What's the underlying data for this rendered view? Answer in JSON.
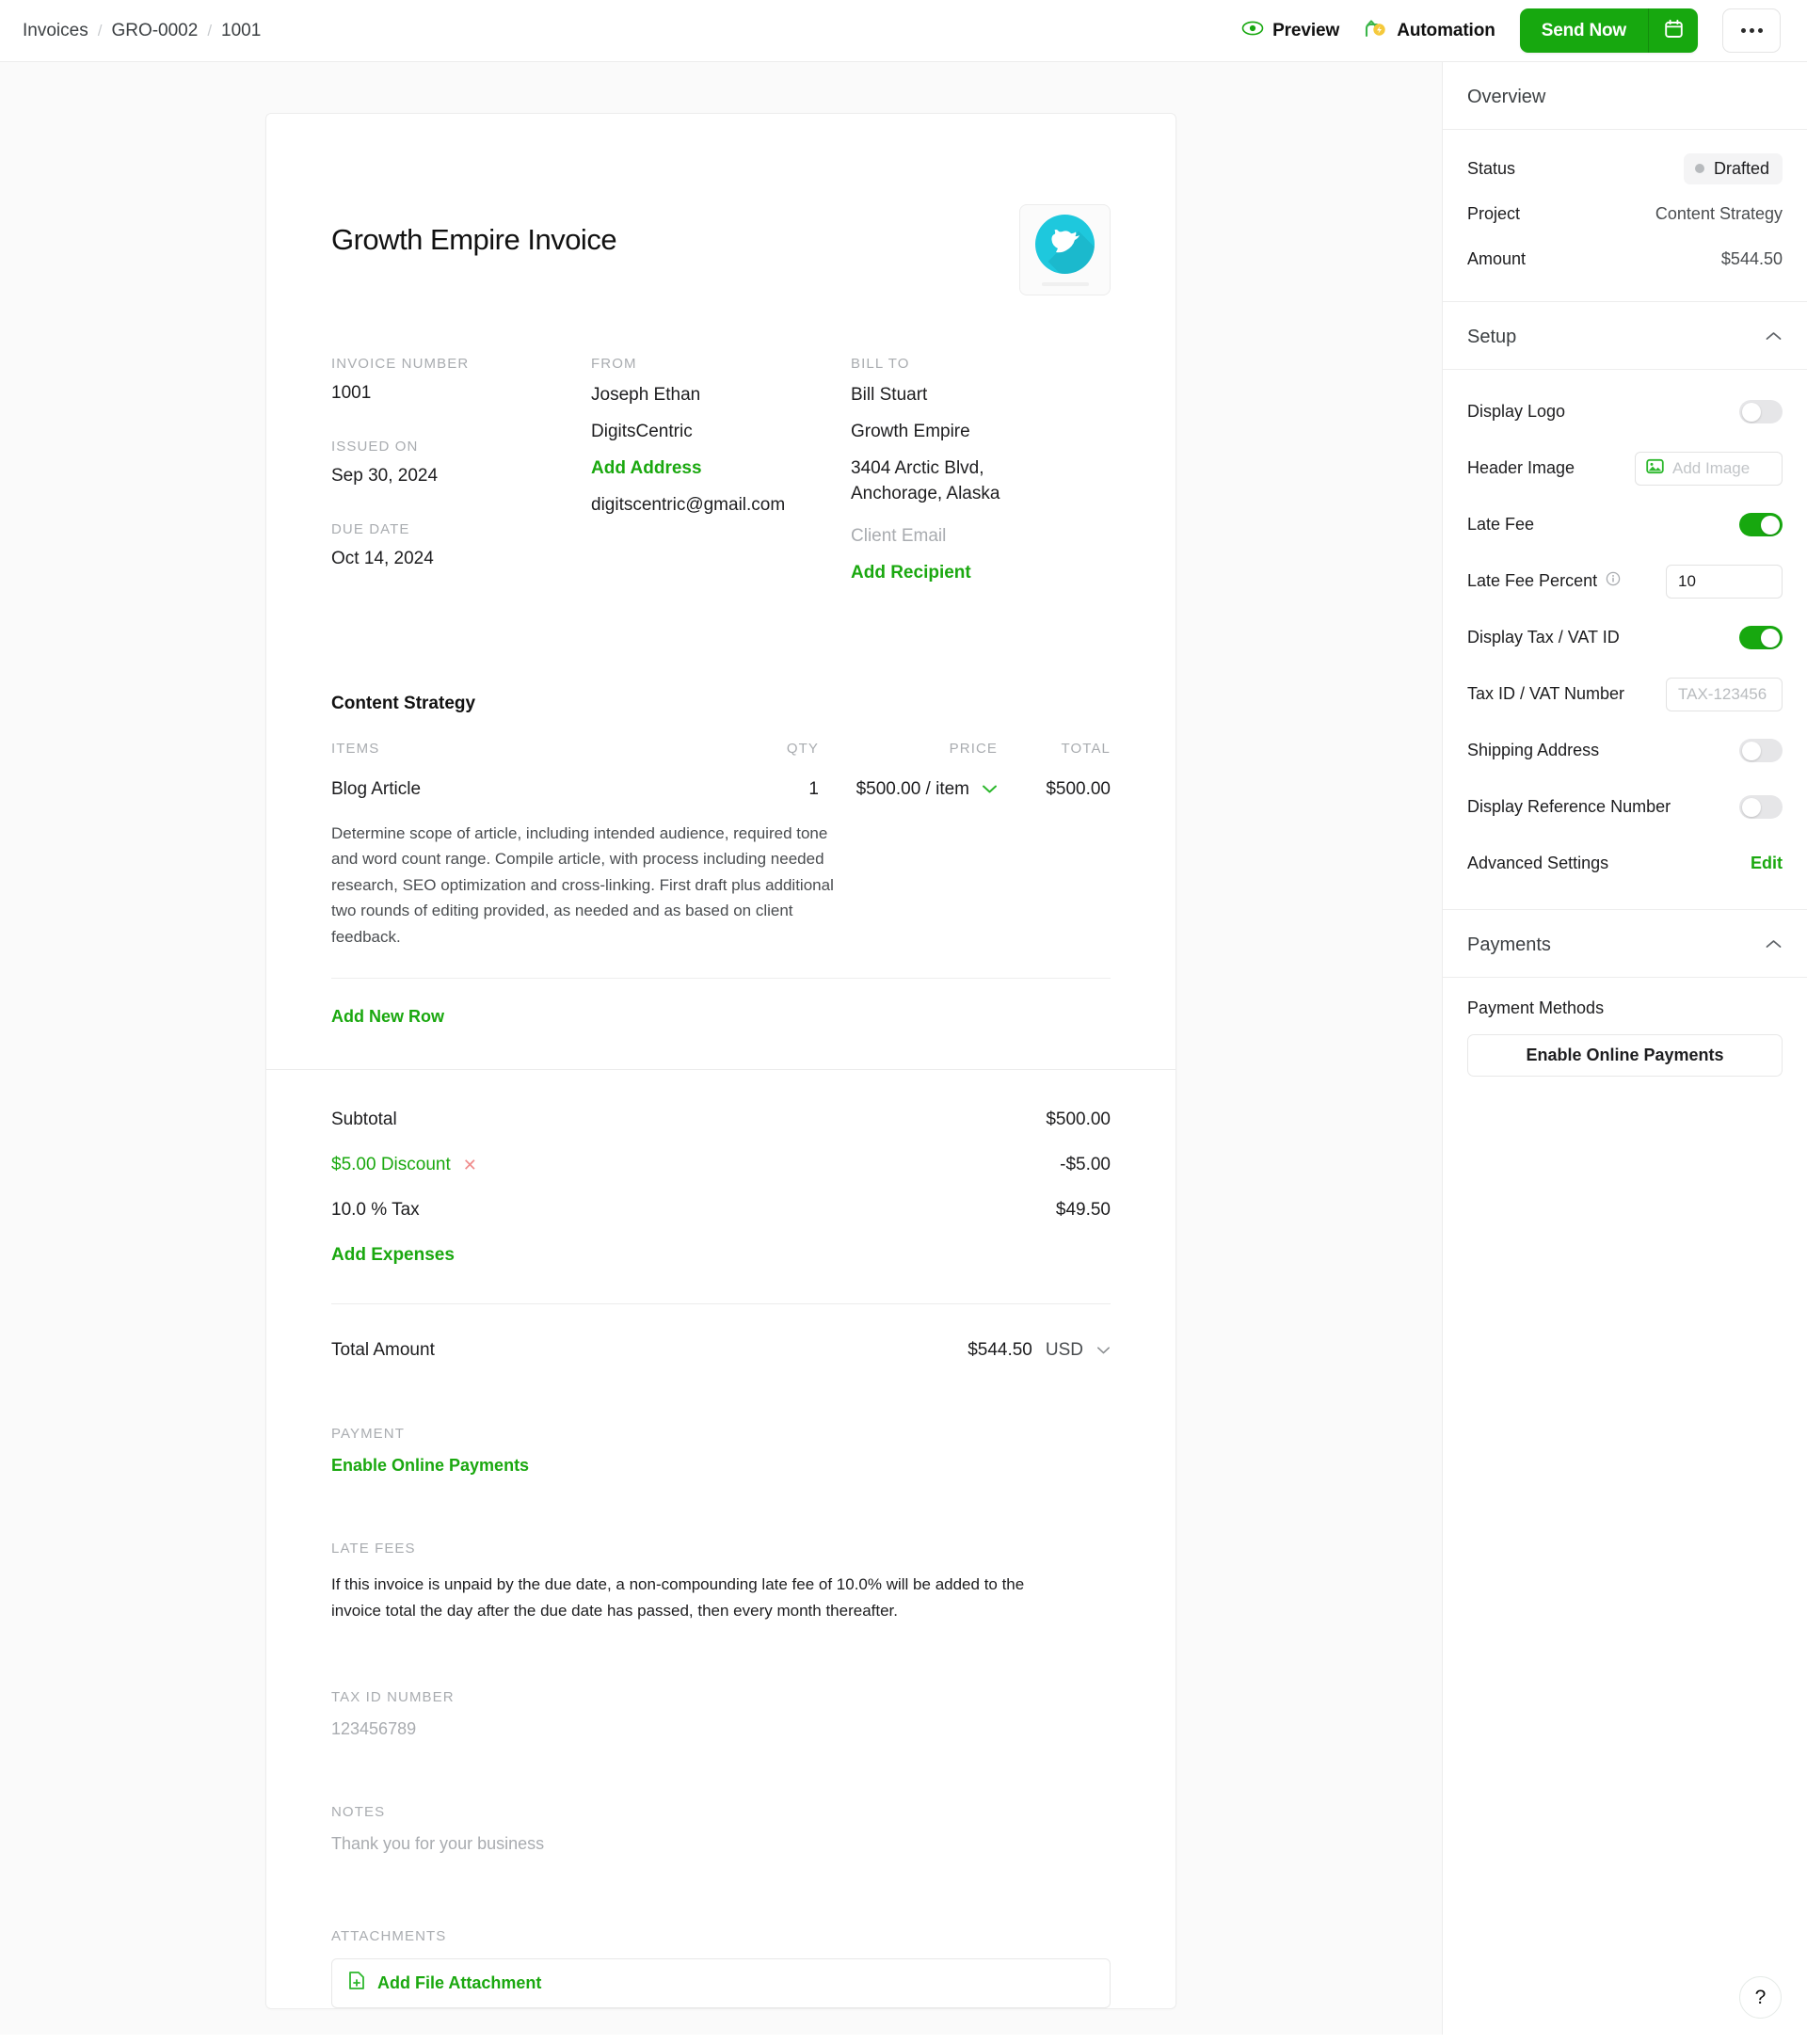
{
  "breadcrumb": {
    "items": [
      "Invoices",
      "GRO-0002",
      "1001"
    ],
    "separator": "/"
  },
  "toolbar": {
    "preview_label": "Preview",
    "automation_label": "Automation",
    "send_label": "Send Now",
    "schedule_icon": "calendar-icon",
    "more_icon": "ellipsis-icon"
  },
  "invoice": {
    "title": "Growth Empire Invoice",
    "logo": {
      "alt": "bird-logo"
    },
    "fields": {
      "invoice_number_label": "INVOICE NUMBER",
      "invoice_number": "1001",
      "issued_on_label": "ISSUED ON",
      "issued_on": "Sep 30, 2024",
      "due_date_label": "DUE DATE",
      "due_date": "Oct 14, 2024",
      "from_label": "FROM",
      "from_name": "Joseph Ethan",
      "from_company": "DigitsCentric",
      "from_add_address": "Add Address",
      "from_email": "digitscentric@gmail.com",
      "bill_to_label": "BILL TO",
      "bill_to_name": "Bill Stuart",
      "bill_to_company": "Growth Empire",
      "bill_to_address": "3404 Arctic Blvd, Anchorage, Alaska",
      "client_email_placeholder": "Client Email",
      "add_recipient": "Add Recipient"
    },
    "project_name": "Content Strategy",
    "table": {
      "headers": {
        "items": "ITEMS",
        "qty": "QTY",
        "price": "PRICE",
        "total": "TOTAL"
      },
      "rows": [
        {
          "name": "Blog Article",
          "qty": "1",
          "price": "$500.00 / item",
          "total": "$500.00",
          "description": "Determine scope of article, including intended audience, required tone and word count range. Compile article, with process including needed research, SEO optimization and cross-linking. First draft plus additional two rounds of editing provided, as needed and as based on client feedback."
        }
      ],
      "add_new_row": "Add New Row"
    },
    "totals": {
      "subtotal_label": "Subtotal",
      "subtotal_value": "$500.00",
      "discount_label": "$5.00 Discount",
      "discount_value": "-$5.00",
      "tax_label": "10.0 % Tax",
      "tax_value": "$49.50",
      "add_expenses": "Add Expenses",
      "total_label": "Total Amount",
      "total_value": "$544.50",
      "currency": "USD"
    },
    "payment": {
      "section_label": "PAYMENT",
      "enable_online_payments": "Enable Online Payments"
    },
    "late_fees": {
      "section_label": "LATE FEES",
      "text": "If this invoice is unpaid by the due date, a non-compounding late fee of 10.0% will be added to the invoice total the day after the due date has passed, then every month thereafter."
    },
    "tax_id": {
      "section_label": "TAX ID NUMBER",
      "value": "123456789"
    },
    "notes": {
      "section_label": "NOTES",
      "placeholder": "Thank you for your business"
    },
    "attachments": {
      "section_label": "ATTACHMENTS",
      "add_label": "Add File Attachment"
    }
  },
  "panel": {
    "overview": {
      "title": "Overview",
      "status_label": "Status",
      "status_value": "Drafted",
      "project_label": "Project",
      "project_value": "Content Strategy",
      "amount_label": "Amount",
      "amount_value": "$544.50"
    },
    "setup": {
      "title": "Setup",
      "display_logo_label": "Display Logo",
      "display_logo_on": false,
      "header_image_label": "Header Image",
      "header_image_placeholder": "Add Image",
      "late_fee_label": "Late Fee",
      "late_fee_on": true,
      "late_fee_percent_label": "Late Fee Percent",
      "late_fee_percent_value": "10",
      "display_tax_vat_label": "Display Tax / VAT ID",
      "display_tax_vat_on": true,
      "tax_id_label": "Tax ID / VAT Number",
      "tax_id_placeholder": "TAX-123456",
      "shipping_address_label": "Shipping Address",
      "shipping_address_on": false,
      "display_reference_label": "Display Reference Number",
      "display_reference_on": false,
      "advanced_settings_label": "Advanced Settings",
      "edit_label": "Edit"
    },
    "payments": {
      "title": "Payments",
      "payment_methods_label": "Payment Methods",
      "enable_button_label": "Enable Online Payments"
    }
  },
  "help": {
    "glyph": "?"
  },
  "colors": {
    "accent_green": "#17a80f",
    "logo_cyan": "#1ec8dd",
    "discount_x": "#f08d8d"
  }
}
